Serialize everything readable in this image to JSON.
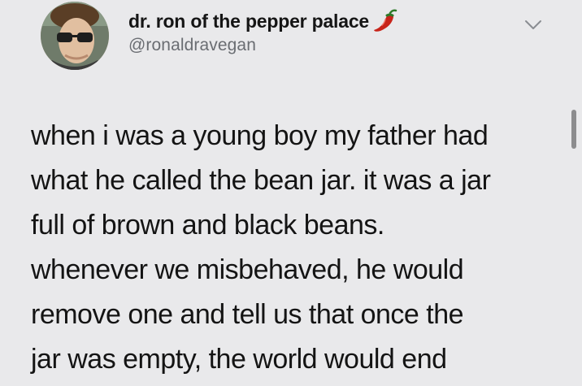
{
  "tweet": {
    "author": {
      "display_name": "dr. ron of the pepper palace",
      "name_emoji": "hot-pepper-icon",
      "handle": "@ronaldravegan",
      "avatar": "avatar"
    },
    "menu_icon": "chevron-down-icon",
    "text_lines": [
      "when i was a young boy my father had",
      "what he called the bean jar. it was a jar",
      "full of brown and black beans.",
      "whenever we misbehaved, he would",
      "remove one and tell us that once the",
      "jar was empty, the world would end"
    ]
  },
  "colors": {
    "background": "#e9e9eb",
    "text": "#141414",
    "handle": "#6a6d72",
    "pepper": "#c8241a"
  }
}
